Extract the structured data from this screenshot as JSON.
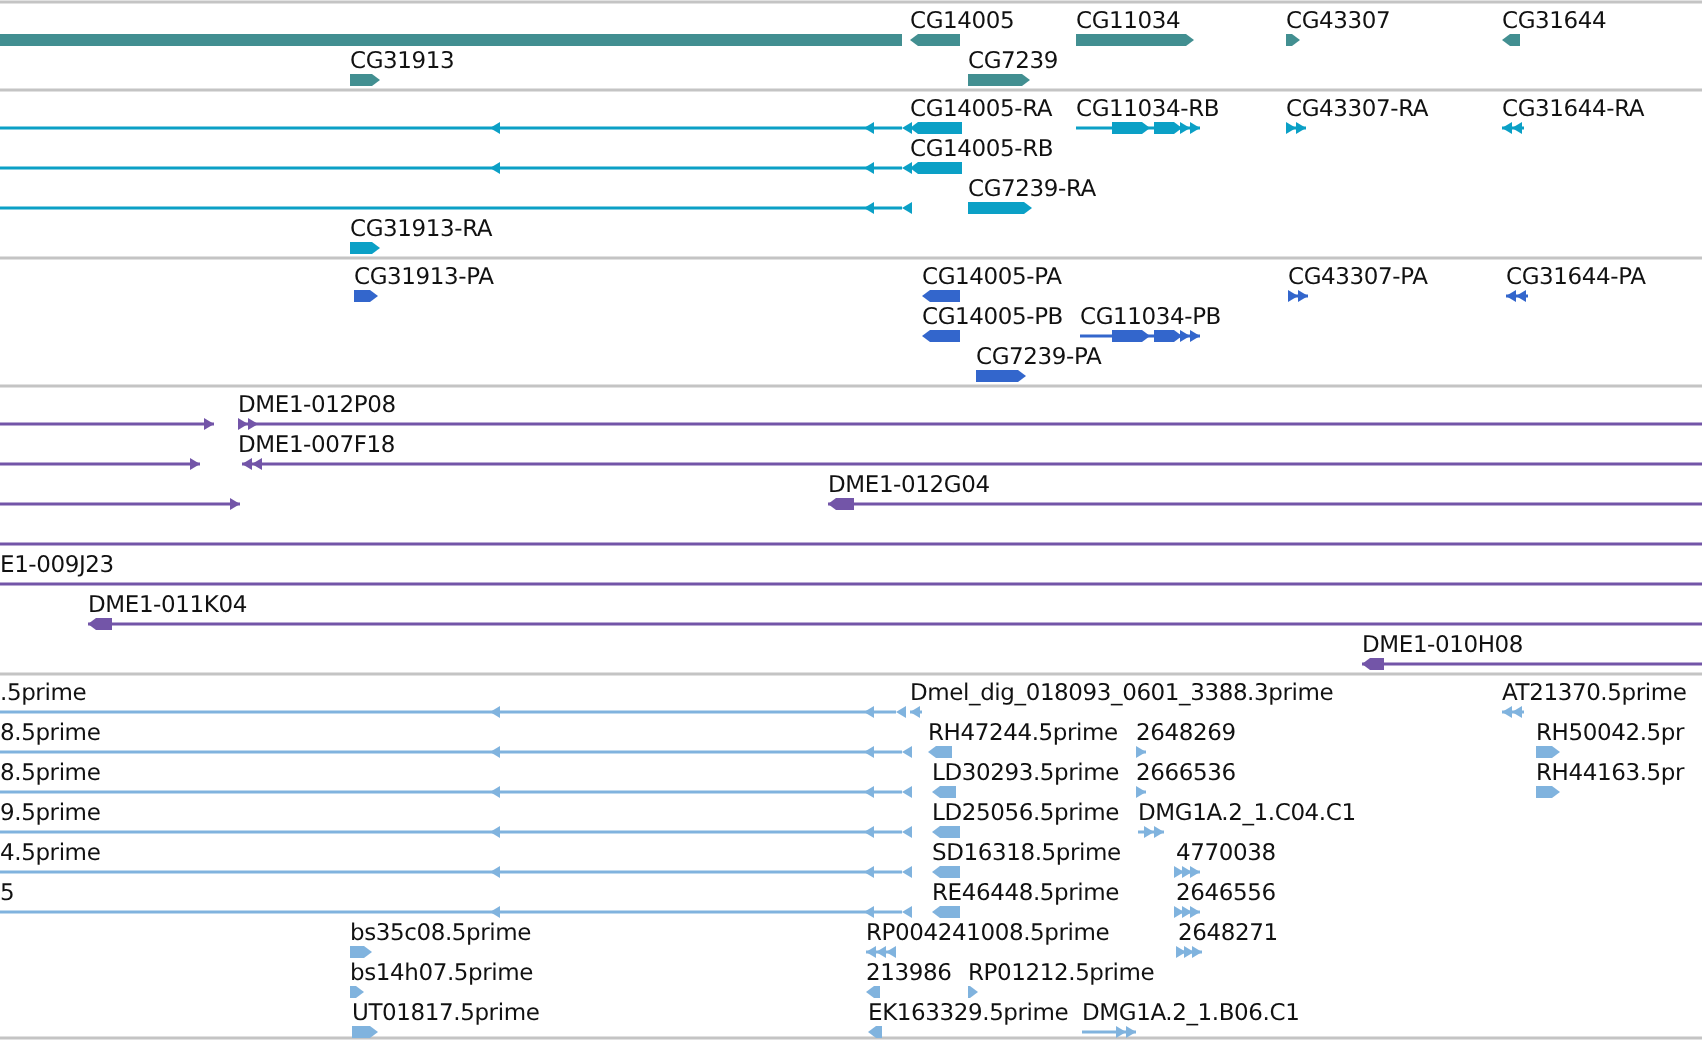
{
  "tracks": [
    {
      "kind": "gene",
      "features": [
        {
          "kind": "bar"
        },
        {
          "kind": "bar",
          "label": "CG14005",
          "reverse": true
        },
        {
          "kind": "bar",
          "label": "CG11034",
          "reverse": false
        },
        {
          "kind": "bar",
          "label": "CG43307",
          "reverse": false
        },
        {
          "kind": "bar",
          "label": "CG31644",
          "reverse": true
        },
        {
          "kind": "bar",
          "label": "CG31913",
          "reverse": false
        },
        {
          "kind": "bar",
          "label": "CG7239",
          "reverse": false
        }
      ]
    },
    {
      "kind": "mrna",
      "features": [
        {
          "kind": "line",
          "reverse": true
        },
        {
          "kind": "bar",
          "label": "CG14005-RA",
          "reverse": true
        },
        {
          "kind": "line",
          "label": "CG11034-RB",
          "reverse": false
        },
        {
          "kind": "line",
          "label": "CG43307-RA",
          "reverse": false
        },
        {
          "kind": "line",
          "label": "CG31644-RA",
          "reverse": true
        },
        {
          "kind": "line",
          "reverse": true
        },
        {
          "kind": "bar",
          "label": "CG14005-RB",
          "reverse": true
        },
        {
          "kind": "line",
          "reverse": true
        },
        {
          "kind": "bar",
          "label": "CG7239-RA",
          "reverse": false
        },
        {
          "kind": "bar",
          "label": "CG31913-RA",
          "reverse": false
        }
      ]
    },
    {
      "kind": "protein",
      "features": [
        {
          "kind": "bar",
          "label": "CG31913-PA",
          "reverse": false
        },
        {
          "kind": "bar",
          "label": "CG14005-PA",
          "reverse": true
        },
        {
          "kind": "line",
          "label": "CG43307-PA",
          "reverse": false
        },
        {
          "kind": "line",
          "label": "CG31644-PA",
          "reverse": true
        },
        {
          "kind": "bar",
          "label": "CG14005-PB",
          "reverse": true
        },
        {
          "kind": "line",
          "label": "CG11034-PB",
          "reverse": false
        },
        {
          "kind": "bar",
          "label": "CG7239-PA",
          "reverse": false
        }
      ]
    },
    {
      "kind": "clone",
      "features": [
        {
          "kind": "line",
          "reverse": false
        },
        {
          "kind": "line",
          "label": "DME1-012P08",
          "reverse": false
        },
        {
          "kind": "line",
          "reverse": false
        },
        {
          "kind": "line",
          "label": "DME1-007F18",
          "reverse": true
        },
        {
          "kind": "line",
          "reverse": false
        },
        {
          "kind": "line",
          "label": "DME1-012G04",
          "reverse": true
        },
        {
          "kind": "line"
        },
        {
          "kind": "line",
          "label": "E1-009J23"
        },
        {
          "kind": "line",
          "label": "DME1-011K04",
          "reverse": true
        },
        {
          "kind": "line",
          "label": "DME1-010H08",
          "reverse": true
        }
      ]
    },
    {
      "kind": "est",
      "features": [
        {
          "kind": "line",
          "label": ".5prime",
          "reverse": true
        },
        {
          "kind": "line",
          "label": "Dmel_dig_018093_0601_3388.3prime",
          "reverse": true
        },
        {
          "kind": "line",
          "label": "AT21370.5prime",
          "reverse": true
        },
        {
          "kind": "line",
          "label": "8.5prime",
          "reverse": true
        },
        {
          "kind": "bar",
          "label": "RH47244.5prime",
          "reverse": true
        },
        {
          "kind": "line",
          "label": "2648269",
          "reverse": false
        },
        {
          "kind": "bar",
          "label": "RH50042.5pr",
          "reverse": false
        },
        {
          "kind": "line",
          "label": "8.5prime",
          "reverse": true
        },
        {
          "kind": "bar",
          "label": "LD30293.5prime",
          "reverse": true
        },
        {
          "kind": "line",
          "label": "2666536",
          "reverse": false
        },
        {
          "kind": "bar",
          "label": "RH44163.5pr",
          "reverse": false
        },
        {
          "kind": "line",
          "label": "9.5prime",
          "reverse": true
        },
        {
          "kind": "bar",
          "label": "LD25056.5prime",
          "reverse": true
        },
        {
          "kind": "line",
          "label": "DMG1A.2_1.C04.C1",
          "reverse": false
        },
        {
          "kind": "line",
          "label": "4.5prime",
          "reverse": true
        },
        {
          "kind": "bar",
          "label": "SD16318.5prime",
          "reverse": true
        },
        {
          "kind": "line",
          "label": "4770038",
          "reverse": false
        },
        {
          "kind": "line",
          "label": "5",
          "reverse": true
        },
        {
          "kind": "bar",
          "label": "RE46448.5prime",
          "reverse": true
        },
        {
          "kind": "line",
          "label": "2646556",
          "reverse": false
        },
        {
          "kind": "bar",
          "label": "bs35c08.5prime",
          "reverse": false
        },
        {
          "kind": "line",
          "label": "RP004241008.5prime",
          "reverse": true
        },
        {
          "kind": "line",
          "label": "2648271",
          "reverse": false
        },
        {
          "kind": "bar",
          "label": "bs14h07.5prime",
          "reverse": false
        },
        {
          "kind": "bar",
          "label": "213986",
          "reverse": true
        },
        {
          "kind": "bar",
          "label": "RP01212.5prime",
          "reverse": false
        },
        {
          "kind": "bar",
          "label": "UT01817.5prime",
          "reverse": false
        },
        {
          "kind": "bar",
          "label": "EK163329.5prime",
          "reverse": true
        },
        {
          "kind": "line",
          "label": "DMG1A.2_1.B06.C1",
          "reverse": false
        }
      ]
    }
  ]
}
